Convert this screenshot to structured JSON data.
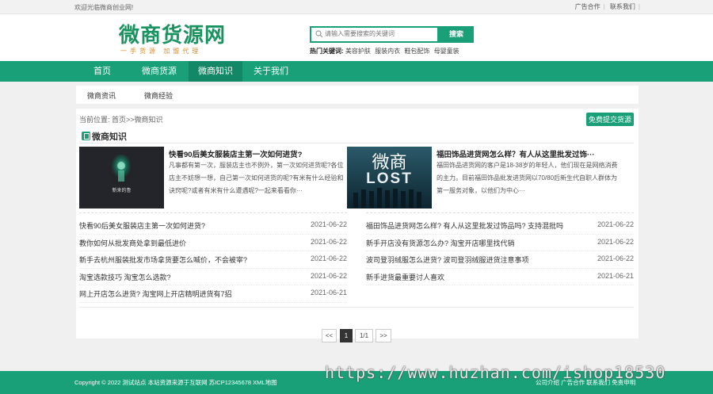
{
  "topbar": {
    "welcome": "欢迎光临微商创业网!",
    "links": [
      "广告合作",
      "联系我们"
    ]
  },
  "header": {
    "logo_main": "微商货源网",
    "logo_sub": "一手货源  加盟代理",
    "search_placeholder": "请输入需要搜索的关键词",
    "search_button": "搜索",
    "hot_label": "热门关键词:",
    "hot_keywords": [
      "美容护肤",
      "服装内衣",
      "鞋包配饰",
      "母婴童装"
    ]
  },
  "nav": {
    "items": [
      "首页",
      "微商货源",
      "微商知识",
      "关于我们"
    ],
    "active": "微商知识"
  },
  "subnav": [
    "微商资讯",
    "微商经验"
  ],
  "main": {
    "breadcrumb": "当前位置: 首页>>微商知识",
    "submit_button": "免费提交货源",
    "section_title": "微商知识",
    "featured": [
      {
        "title": "快看90后美女服装店主第一次如何进货?",
        "desc": "凡事都有第一次，服装店主也不例外，第一次如何进货呢?各位店主不妨想一想，自己第一次如何进货的呢?有米有什么经验和诀窍呢?或者有米有什么遭遇呢?一起来看看你···",
        "thumb_caption": "新来的鲁"
      },
      {
        "title": "福田饰品进货网怎么样？有人从这里批发过饰···",
        "desc": "福田饰品进货网的客户是18-38岁的年轻人，他们现在是网络消费的主力。目前福田饰品批发进货网以70/80后新生代自职人群体为第一服务对象，以他们为中心···",
        "thumb_text_top": "微商",
        "thumb_text_bottom": "LOST"
      }
    ],
    "list_left": [
      {
        "title": "快看90后美女服装店主第一次如何进货?",
        "date": "2021-06-22"
      },
      {
        "title": "教你如何从批发商处拿到最低进价",
        "date": "2021-06-22"
      },
      {
        "title": "新手去杭州服装批发市场拿货要怎么喊价，不会被宰?",
        "date": "2021-06-22"
      },
      {
        "title": "淘宝选款技巧 淘宝怎么选款?",
        "date": "2021-06-22"
      },
      {
        "title": "网上开店怎么进货? 淘宝网上开店精明进货有7招",
        "date": "2021-06-21"
      }
    ],
    "list_right": [
      {
        "title": "福田饰品进货网怎么样? 有人从这里批发过饰品吗? 支持混批吗",
        "date": "2021-06-22"
      },
      {
        "title": "新手开店没有货源怎么办? 淘宝开店哪里找代销",
        "date": "2021-06-22"
      },
      {
        "title": "波司登羽绒服怎么进货? 波司登羽绒服进货注意事项",
        "date": "2021-06-22"
      },
      {
        "title": "新手进货最重要讨人喜欢",
        "date": "2021-06-21"
      }
    ],
    "pager": {
      "prev": "<<",
      "current": "1",
      "pages": "1/1",
      "next": ">>"
    }
  },
  "footer": {
    "copyright": "Copyright © 2022 测试站点 本站资源来源于互联网 苏ICP12345678 XML地图",
    "links": "公司介绍 广告合作 联系我们 免责申明"
  },
  "watermark": "https://www.huzhan.com/ishop18530",
  "colors": {
    "brand": "#19a078",
    "logo": "#19935f",
    "accent": "#e08a23"
  }
}
